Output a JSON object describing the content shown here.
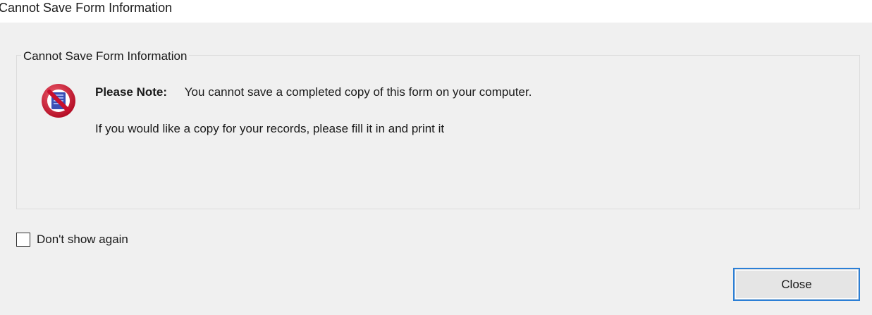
{
  "window": {
    "title": "Cannot Save Form Information"
  },
  "group": {
    "legend": "Cannot Save Form Information"
  },
  "message": {
    "icon": "no-save-icon",
    "note_label": "Please Note:",
    "note_text": "You cannot save a completed copy of this form on your computer.",
    "second_line": "If you would like a copy for your records, please fill it in and print it"
  },
  "options": {
    "dont_show_label": "Don't show again",
    "dont_show_checked": false
  },
  "buttons": {
    "close_label": "Close"
  },
  "colors": {
    "dialog_bg": "#f0f0f0",
    "button_focus_border": "#2b7fd6",
    "icon_red": "#c8102e",
    "icon_blue": "#3a4fb5"
  }
}
